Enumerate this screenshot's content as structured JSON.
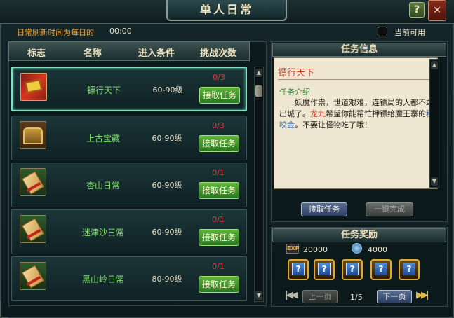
{
  "window": {
    "title": "单人日常",
    "help_label": "?",
    "close_label": "✕"
  },
  "top": {
    "refresh_label": "日常刷新时间为每日的",
    "refresh_time": "00:00",
    "filter_label": "当前可用",
    "filter_checked": false
  },
  "table": {
    "headers": [
      "标志",
      "名称",
      "进入条件",
      "挑战次数"
    ],
    "rows": [
      {
        "icon": "red-book-icon",
        "name": "镖行天下",
        "condition": "60-90级",
        "count": "0/3",
        "button": "接取任务",
        "selected": true
      },
      {
        "icon": "treasure-chest-icon",
        "name": "上古宝藏",
        "condition": "60-90级",
        "count": "0/3",
        "button": "接取任务",
        "selected": false
      },
      {
        "icon": "scroll-icon",
        "name": "杏山日常",
        "condition": "60-90级",
        "count": "0/1",
        "button": "接取任务",
        "selected": false
      },
      {
        "icon": "scroll-icon",
        "name": "迷津沙日常",
        "condition": "60-90级",
        "count": "0/1",
        "button": "接取任务",
        "selected": false
      },
      {
        "icon": "scroll-icon",
        "name": "黑山岭日常",
        "condition": "80-90级",
        "count": "0/1",
        "button": "接取任务",
        "selected": false
      }
    ]
  },
  "info": {
    "header": "任务信息",
    "quest_title": "镖行天下",
    "intro_heading": "任务介绍",
    "intro_part1": "妖魔作祟，世道艰难，连镖局的人都不敢出城了。",
    "intro_name1": "龙九",
    "intro_part2": "希望你能帮忙押镖给魔王寨的",
    "intro_name2": "程咬金",
    "intro_part3": "。不要让怪物吃了哦！",
    "accept_button": "接取任务",
    "complete_button": "一键完成"
  },
  "rewards": {
    "header": "任务奖励",
    "exp_icon_label": "EXP",
    "exp": "20000",
    "coin": "4000",
    "slot_label": "?",
    "slots": [
      "?",
      "?",
      "?",
      "?",
      "?"
    ],
    "prev_label": "上一页",
    "next_label": "下一页",
    "page": "1/5",
    "first_label": "|◀◀",
    "last_label": "▶▶|"
  },
  "colors": {
    "accent_green": "#7fe36a",
    "count_red": "#e0393a",
    "quest_title": "#c5442a"
  }
}
